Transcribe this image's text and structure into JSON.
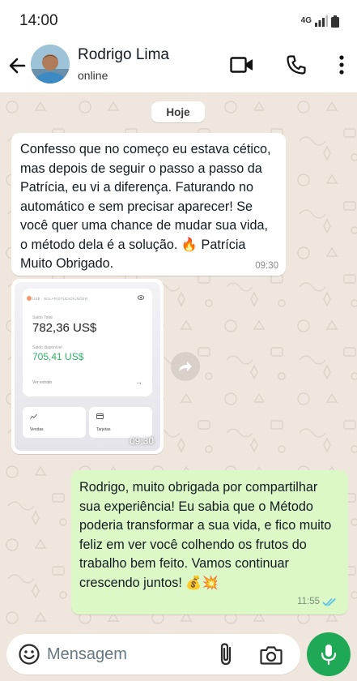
{
  "status_bar": {
    "time": "14:00",
    "network": "4G"
  },
  "header": {
    "contact_name": "Rodrigo Lima",
    "contact_status": "online"
  },
  "chat": {
    "day_label": "Hoje",
    "messages": [
      {
        "direction": "incoming",
        "text": "Confesso que no começo eu estava cético, mas depois de seguir o passo a passo da Patrícia, eu vi a diferença. Faturando no automático e sem precisar aparecer! Se você quer uma chance de mudar sua vida, o método dela é a solução. 🔥 Patrícia Muito Obrigado.",
        "time": "09:30"
      },
      {
        "direction": "incoming",
        "type": "image",
        "time": "09:30",
        "image_content": {
          "header": "US$ · SOLAR/STUDIO/UNDER",
          "total_label": "Saldo Total",
          "total_value": "782,36 US$",
          "available_label": "Saldo disponível",
          "available_value": "705,41 US$",
          "extract_label": "Ver extrato",
          "tile_left": "Vendas",
          "tile_right": "Tarjetas"
        }
      },
      {
        "direction": "outgoing",
        "text": "Rodrigo, muito obrigada por compartilhar sua experiência! Eu sabia que o Método poderia transformar a sua vida, e fico muito feliz em ver você colhendo os frutos do trabalho bem feito. Vamos continuar crescendo juntos! 💰💥",
        "time": "11:55",
        "read": true
      }
    ]
  },
  "composer": {
    "placeholder": "Mensagem"
  },
  "colors": {
    "accent": "#1fa855",
    "outgoing_bubble": "#dcf8c6",
    "incoming_bubble": "#ffffff",
    "read_ticks": "#53bdeb",
    "chat_bg": "#efe7de"
  }
}
